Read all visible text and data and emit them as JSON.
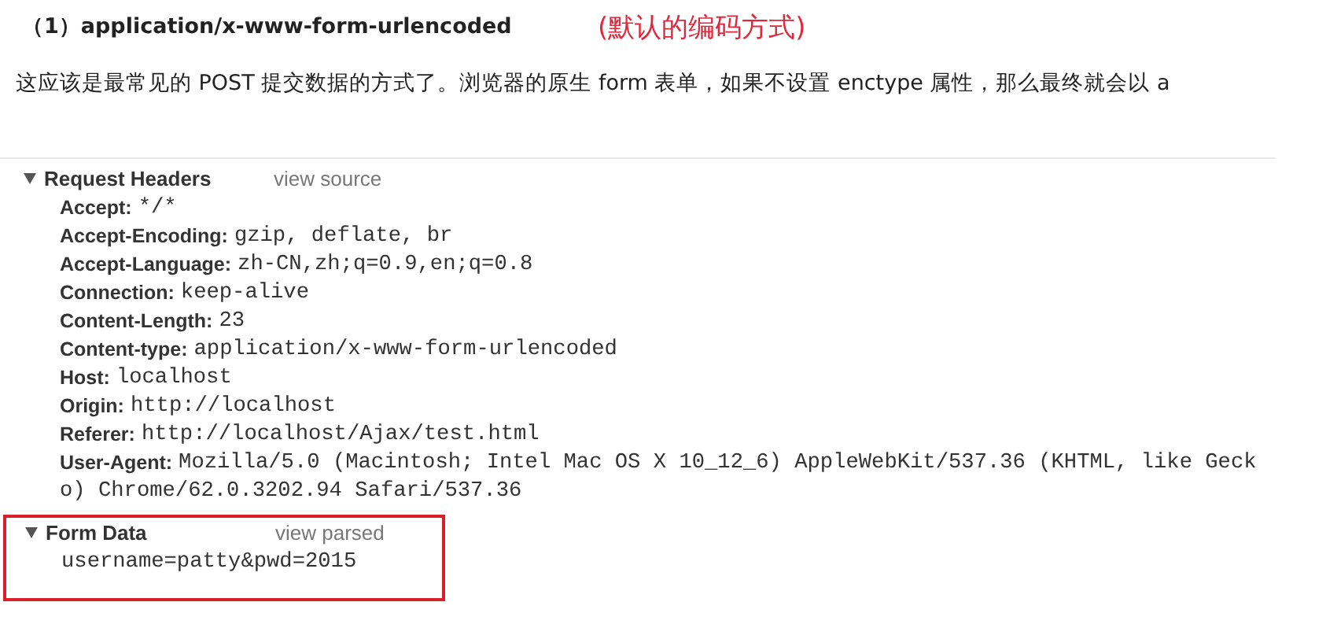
{
  "heading": {
    "text": "（1）application/x-www-form-urlencoded",
    "note": "(默认的编码方式)"
  },
  "paragraph": "这应该是最常见的 POST 提交数据的方式了。浏览器的原生 form 表单，如果不设置 enctype 属性，那么最终就会以 a",
  "sections": [
    {
      "title": "Request Headers",
      "link": "view source",
      "expanded": true,
      "highlighted": false,
      "kind": "headers",
      "headers": [
        {
          "name": "Accept:",
          "value": "*/*"
        },
        {
          "name": "Accept-Encoding:",
          "value": "gzip, deflate, br"
        },
        {
          "name": "Accept-Language:",
          "value": "zh-CN,zh;q=0.9,en;q=0.8"
        },
        {
          "name": "Connection:",
          "value": "keep-alive"
        },
        {
          "name": "Content-Length:",
          "value": "23"
        },
        {
          "name": "Content-type:",
          "value": "application/x-www-form-urlencoded"
        },
        {
          "name": "Host:",
          "value": "localhost"
        },
        {
          "name": "Origin:",
          "value": "http://localhost"
        },
        {
          "name": "Referer:",
          "value": "http://localhost/Ajax/test.html"
        },
        {
          "name": "User-Agent:",
          "value": "Mozilla/5.0 (Macintosh; Intel Mac OS X 10_12_6) AppleWebKit/537.36 (KHTML, like Geck",
          "continuation": "o) Chrome/62.0.3202.94 Safari/537.36"
        }
      ]
    },
    {
      "title": "Form Data",
      "link": "view parsed",
      "expanded": true,
      "highlighted": true,
      "kind": "form",
      "body": "username=patty&pwd=2015"
    }
  ]
}
